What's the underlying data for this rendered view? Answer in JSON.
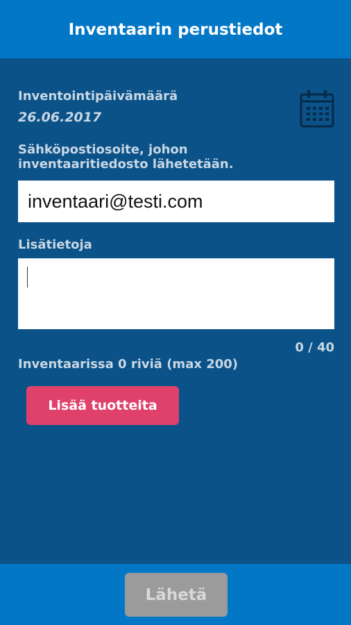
{
  "header": {
    "title": "Inventaarin perustiedot"
  },
  "form": {
    "date_label": "Inventointipäivämäärä",
    "date_value": "26.06.2017",
    "calendar_icon": "calendar-icon",
    "email_label_line1": "Sähköpostiosoite, johon",
    "email_label_line2": "inventaaritiedosto lähetetään.",
    "email_value": "inventaari@testi.com",
    "notes_label": "Lisätietoja",
    "notes_value": "",
    "notes_counter": "0 / 40",
    "rows_info": "Inventaarissa 0 riviä (max 200)",
    "add_button_label": "Lisää tuotteita"
  },
  "footer": {
    "send_button_label": "Lähetä",
    "send_enabled": false
  },
  "colors": {
    "header_bg": "#0277c6",
    "main_bg": "#0a5288",
    "accent_button": "#e0416a",
    "disabled_button": "#9b9b9b"
  }
}
